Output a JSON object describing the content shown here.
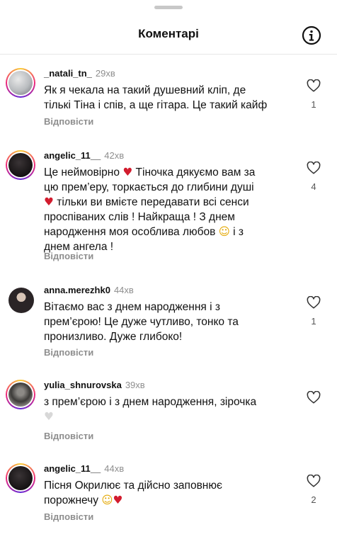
{
  "header": {
    "title": "Коментарі"
  },
  "icons": {
    "like": "heart-outline-icon",
    "info": "info-icon"
  },
  "colors": {
    "text": "#111111",
    "secondary": "#8e8e8e",
    "divider": "#e6e6e6"
  },
  "comments": [
    {
      "username": "_natali_tn_",
      "time": "29хв",
      "lines": [
        "Як я чекала на такий душевний кліп, де",
        "тількі  Тіна і спів, а ще гітара. Це такий кайф"
      ],
      "reply": "Відповісти",
      "likes": "1"
    },
    {
      "username": "angelic_11__",
      "time": "42хв",
      "l1": "Це неймовірно",
      "l1b": "Тіночка дякуємо вам за",
      "l2": "цю прем’еру, торкається до глибини душі",
      "l3": "тільки ви вмієте передавати всі сенси",
      "l4": "проспіваних слів ! Найкраща ! З днем",
      "l5a": "народження моя особлива любов",
      "l5b": "і з",
      "l6": "днем ангела !",
      "reply": "Відповісти",
      "likes": "4"
    },
    {
      "username": "anna.merezhk0",
      "time": "44хв",
      "lines": [
        "Вітаємо вас з днем народження і з",
        "прем’єрою! Це дуже чутливо, тонко та",
        "пронизливо. Дуже глибоко!"
      ],
      "reply": "Відповісти",
      "likes": "1"
    },
    {
      "username": "yulia_shnurovska",
      "time": "39хв",
      "lines": [
        "з прем’єрою і з днем народження, зірочка"
      ],
      "reply": "Відповісти",
      "likes": ""
    },
    {
      "username": "angelic_11__",
      "time": "44хв",
      "lines": [
        "Пісня Окрилює та дійсно заповнює",
        "порожнечу"
      ],
      "reply": "Відповісти",
      "likes": "2"
    }
  ]
}
